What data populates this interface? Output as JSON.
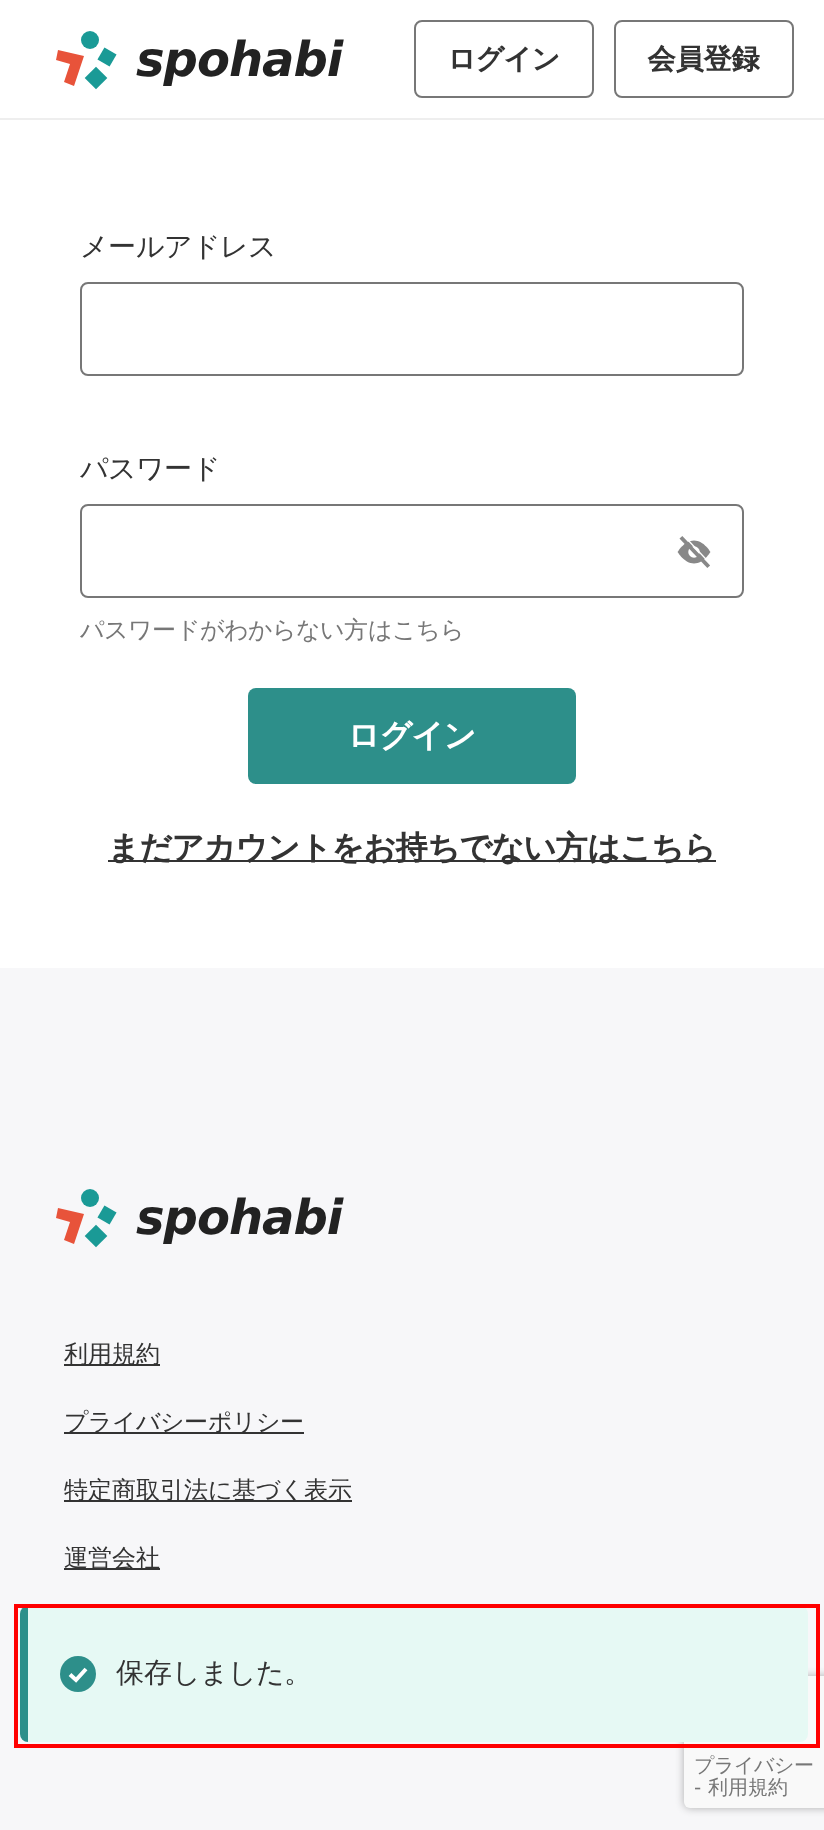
{
  "header": {
    "logo": "spohabi",
    "buttons": [
      "ログイン",
      "会員登録"
    ]
  },
  "form": {
    "fields": [
      {
        "label": "メールアドレス",
        "kind": "text"
      },
      {
        "label": "パスワード",
        "kind": "password"
      }
    ],
    "forgot_link": "パスワードがわからない方はこちら",
    "submit": "ログイン",
    "signup_link": "まだアカウントをお持ちでない方はこちら"
  },
  "footer": {
    "logo": "spohabi",
    "links": [
      "利用規約",
      "プライバシーポリシー",
      "特定商取引法に基づく表示",
      "運営会社"
    ]
  },
  "toast": {
    "message": "保存しました。"
  },
  "recaptcha": {
    "lines": [
      "プライバシー",
      "- 利用規約"
    ]
  }
}
